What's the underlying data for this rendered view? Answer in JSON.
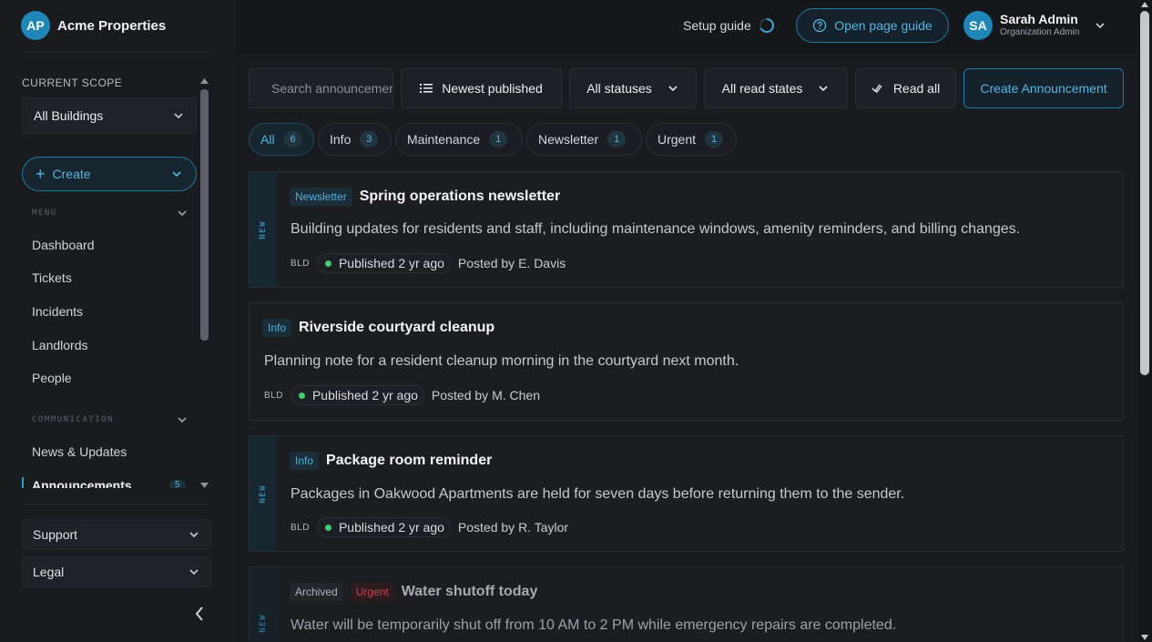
{
  "brand": {
    "initials": "AP",
    "name": "Acme Properties"
  },
  "scope": {
    "label": "CURRENT SCOPE",
    "value": "All Buildings"
  },
  "create": {
    "label": "Create"
  },
  "menu": {
    "title": "MENU",
    "items": [
      "Dashboard",
      "Tickets",
      "Incidents",
      "Landlords",
      "People"
    ]
  },
  "communication": {
    "title": "COMMUNICATION",
    "items": [
      "News & Updates",
      "Announcements"
    ],
    "announcements_badge": "5"
  },
  "footer": {
    "support": "Support",
    "legal": "Legal"
  },
  "topbar": {
    "setup_guide": "Setup guide",
    "open_guide": "Open page guide",
    "user": {
      "initials": "SA",
      "name": "Sarah Admin",
      "role": "Organization Admin"
    }
  },
  "toolbar": {
    "search_placeholder": "Search announcements",
    "sort": "Newest published",
    "status_filter": "All statuses",
    "read_filter": "All read states",
    "read_all": "Read all",
    "create_announcement": "Create Announcement"
  },
  "chips": [
    {
      "label": "All",
      "count": "6"
    },
    {
      "label": "Info",
      "count": "3"
    },
    {
      "label": "Maintenance",
      "count": "1"
    },
    {
      "label": "Newsletter",
      "count": "1"
    },
    {
      "label": "Urgent",
      "count": "1"
    }
  ],
  "cards": [
    {
      "stripe": "NEW",
      "tags": [
        "Newsletter"
      ],
      "title": "Spring operations newsletter",
      "description": "Building updates for residents and staff, including maintenance windows, amenity reminders, and billing changes.",
      "bld": "BLD",
      "status": "Published 2 yr ago",
      "posted_by": "Posted by E. Davis"
    },
    {
      "tags": [
        "Info"
      ],
      "title": "Riverside courtyard cleanup",
      "description": "Planning note for a resident cleanup morning in the courtyard next month.",
      "bld": "BLD",
      "status": "Published 2 yr ago",
      "posted_by": "Posted by M. Chen"
    },
    {
      "stripe": "NEW",
      "tags": [
        "Info"
      ],
      "title": "Package room reminder",
      "description": "Packages in Oakwood Apartments are held for seven days before returning them to the sender.",
      "bld": "BLD",
      "status": "Published 2 yr ago",
      "posted_by": "Posted by R. Taylor"
    },
    {
      "stripe": "NEW",
      "tags": [
        "Archived",
        "Urgent"
      ],
      "title": "Water shutoff today",
      "description": "Water will be temporarily shut off from 10 AM to 2 PM while emergency repairs are completed."
    }
  ],
  "colors": {
    "accent": "#52b6e3",
    "accent_border": "#1c7aa4",
    "published_dot": "#3fcf6e",
    "urgent": "#c4434f",
    "background": "#16171b",
    "panel": "#1a1b1f"
  }
}
